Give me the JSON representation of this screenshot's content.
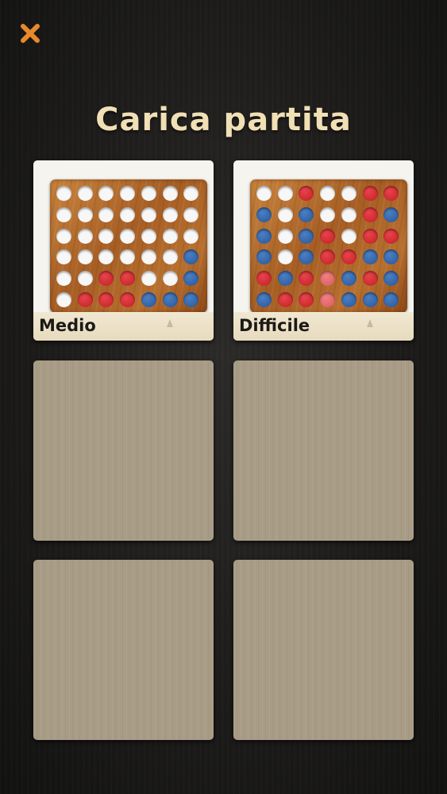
{
  "header": {
    "close_icon": "close-x-icon",
    "close_color": "#e8892a"
  },
  "title": "Carica partita",
  "slots": [
    {
      "label": "Medio",
      "board": [
        "eeeeeee",
        "eeeeeee",
        "eeeeeee",
        "eeeeeeb",
        "eerreeb",
        "errrbbb"
      ]
    },
    {
      "label": "Difficile",
      "board": [
        "eereerr",
        "bebeerb",
        "bebrerr",
        "bebrrbb",
        "rbrpbrb",
        "brrpbbb"
      ]
    },
    {
      "label": null
    },
    {
      "label": null
    },
    {
      "label": null
    },
    {
      "label": null
    }
  ],
  "colors": {
    "red_disc": "#c8232a",
    "blue_disc": "#2f5ea6",
    "pink_disc": "#e06a6e",
    "empty_hole": "#f7f7f7",
    "title": "#f1dfb5"
  }
}
